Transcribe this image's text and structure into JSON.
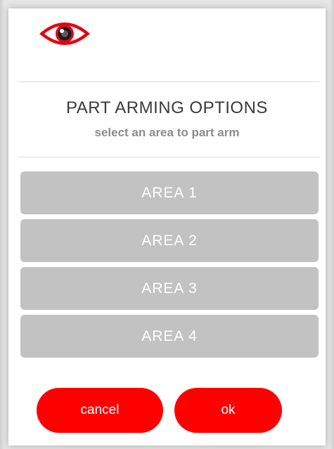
{
  "header": {
    "icon": "eye-icon",
    "accent_color": "#e30613"
  },
  "dialog": {
    "title": "PART ARMING OPTIONS",
    "subtitle": "select an area to part arm"
  },
  "areas": [
    {
      "label": "AREA  1"
    },
    {
      "label": "AREA  2"
    },
    {
      "label": "AREA  3"
    },
    {
      "label": "AREA  4"
    }
  ],
  "actions": {
    "cancel_label": "cancel",
    "ok_label": "ok",
    "button_color": "#ff0000"
  }
}
